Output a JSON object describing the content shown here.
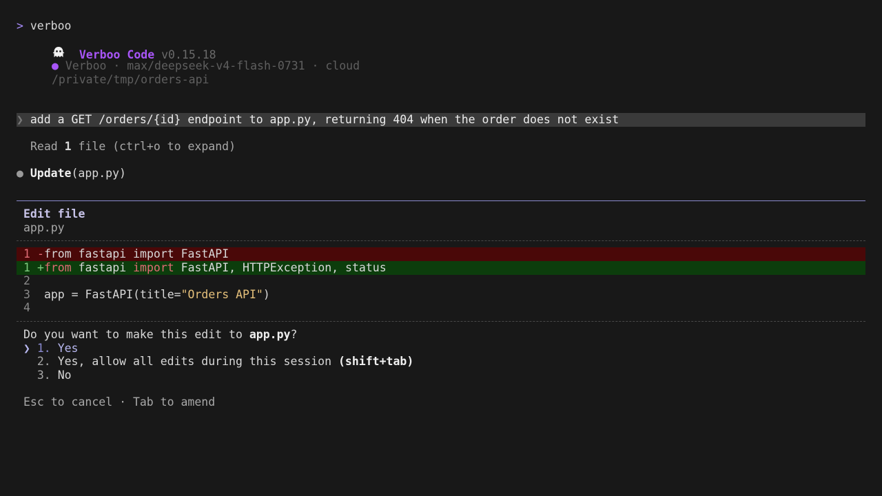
{
  "shell": {
    "caret": ">",
    "command": "verboo"
  },
  "banner": {
    "icon": "ghost-icon",
    "app_name": "Verboo Code",
    "version": "v0.15.18",
    "status_dot": "●",
    "provider_line": "Verboo · max/deepseek-v4-flash-0731 · cloud",
    "cwd": "/private/tmp/orders-api"
  },
  "user_message": {
    "chevron": "❯",
    "text": "add a GET /orders/{id} endpoint to app.py, returning 404 when the order does not exist"
  },
  "activity": {
    "read_prefix": "Read ",
    "read_count": "1",
    "read_suffix": " file (ctrl+o to expand)",
    "update_bullet": "●",
    "update_tool": "Update",
    "update_arg": "(app.py)"
  },
  "edit_panel": {
    "title": "Edit file",
    "filename": "app.py",
    "diff": {
      "del": {
        "line": "1",
        "sign": "-",
        "pre": "from fastapi ",
        "kw": "import",
        "post": " FastAPI"
      },
      "add": {
        "line": "1",
        "sign": "+",
        "kw1": "from",
        "mid": " fastapi ",
        "kw2": "import",
        "post": " FastAPI, HTTPException, status"
      },
      "l2": {
        "line": "2"
      },
      "l3": {
        "line": "3",
        "pre": "app = FastAPI(title=",
        "str": "\"Orders API\"",
        "post": ")"
      },
      "l4": {
        "line": "4"
      }
    },
    "question_pre": "Do you want to make this edit to ",
    "question_file": "app.py",
    "question_post": "?",
    "options": [
      {
        "marker": "❯",
        "num": "1.",
        "label": "Yes",
        "hint": ""
      },
      {
        "marker": " ",
        "num": "2.",
        "label": "Yes, allow all edits during this session ",
        "hint": "(shift+tab)"
      },
      {
        "marker": " ",
        "num": "3.",
        "label": "No",
        "hint": ""
      }
    ],
    "footer": "Esc to cancel · Tab to amend"
  },
  "colors": {
    "background": "#181818",
    "accent": "#a855f7",
    "diff_del_bg": "#4a0808",
    "diff_add_bg": "#0c3d0c",
    "rule": "#8b8bd0"
  }
}
